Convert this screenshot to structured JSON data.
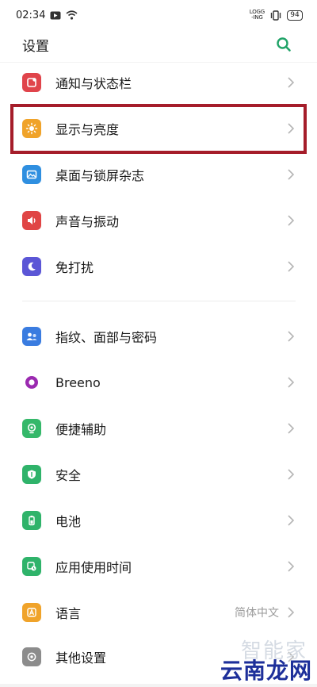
{
  "status_bar": {
    "time": "02:34",
    "network_label_top": "LOGG",
    "network_label_bottom": "-ING",
    "battery": "94"
  },
  "header": {
    "title": "设置"
  },
  "items": [
    {
      "label": "通知与状态栏",
      "icon": "notification-icon",
      "icon_color": "#e0444b"
    },
    {
      "label": "显示与亮度",
      "icon": "brightness-icon",
      "icon_color": "#f0a32a"
    },
    {
      "label": "桌面与锁屏杂志",
      "icon": "wallpaper-icon",
      "icon_color": "#2f8fe0"
    },
    {
      "label": "声音与振动",
      "icon": "sound-icon",
      "icon_color": "#e04545"
    },
    {
      "label": "免打扰",
      "icon": "moon-icon",
      "icon_color": "#5b56d6"
    },
    {
      "label": "指纹、面部与密码",
      "icon": "fingerprint-icon",
      "icon_color": "#3a7ce0"
    },
    {
      "label": "Breeno",
      "icon": "breeno-icon",
      "icon_color": "#9b2ab0"
    },
    {
      "label": "便捷辅助",
      "icon": "assist-icon",
      "icon_color": "#35b86a"
    },
    {
      "label": "安全",
      "icon": "shield-icon",
      "icon_color": "#2fb36a"
    },
    {
      "label": "电池",
      "icon": "battery-icon",
      "icon_color": "#2fb36a"
    },
    {
      "label": "应用使用时间",
      "icon": "app-time-icon",
      "icon_color": "#2fb36a"
    },
    {
      "label": "语言",
      "value": "简体中文",
      "icon": "language-icon",
      "icon_color": "#f0a32a"
    },
    {
      "label": "其他设置",
      "icon": "other-settings-icon",
      "icon_color": "#8c8c8c"
    }
  ],
  "watermark": {
    "top": "智能家",
    "bottom": "云南龙网"
  },
  "colors": {
    "accent": "#20a368",
    "highlight": "#a51d2a"
  }
}
